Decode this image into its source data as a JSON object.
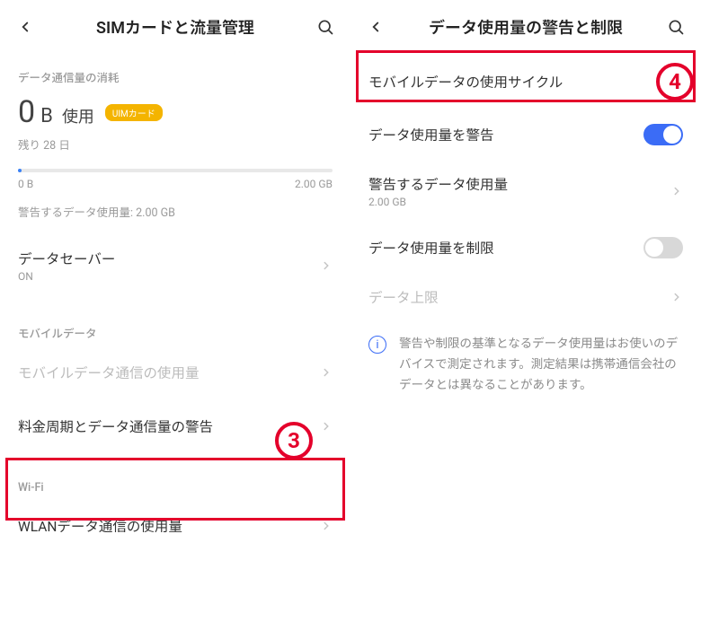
{
  "left": {
    "title": "SIMカードと流量管理",
    "section_usage": "データ通信量の消耗",
    "usage_num": "0",
    "usage_unit": "B",
    "usage_used_label": "使用",
    "uim_chip": "UIMカード",
    "remaining": "残り 28 日",
    "scale_min": "0 B",
    "scale_max": "2.00 GB",
    "warn_line": "警告するデータ使用量: 2.00 GB",
    "data_saver_label": "データセーバー",
    "data_saver_state": "ON",
    "section_mobile": "モバイルデータ",
    "mobile_usage_row": "モバイルデータ通信の使用量",
    "billing_warning_row": "料金周期とデータ通信量の警告",
    "section_wifi": "Wi-Fi",
    "wlan_row": "WLANデータ通信の使用量",
    "badge3": "3"
  },
  "right": {
    "title": "データ使用量の警告と制限",
    "cycle_row": "モバイルデータの使用サイクル",
    "warn_toggle_label": "データ使用量を警告",
    "warn_amount_label": "警告するデータ使用量",
    "warn_amount_value": "2.00 GB",
    "limit_toggle_label": "データ使用量を制限",
    "limit_value_label": "データ上限",
    "info_text": "警告や制限の基準となるデータ使用量はお使いのデバイスで測定されます。測定結果は携帯通信会社のデータとは異なることがあります。",
    "badge4": "4"
  }
}
